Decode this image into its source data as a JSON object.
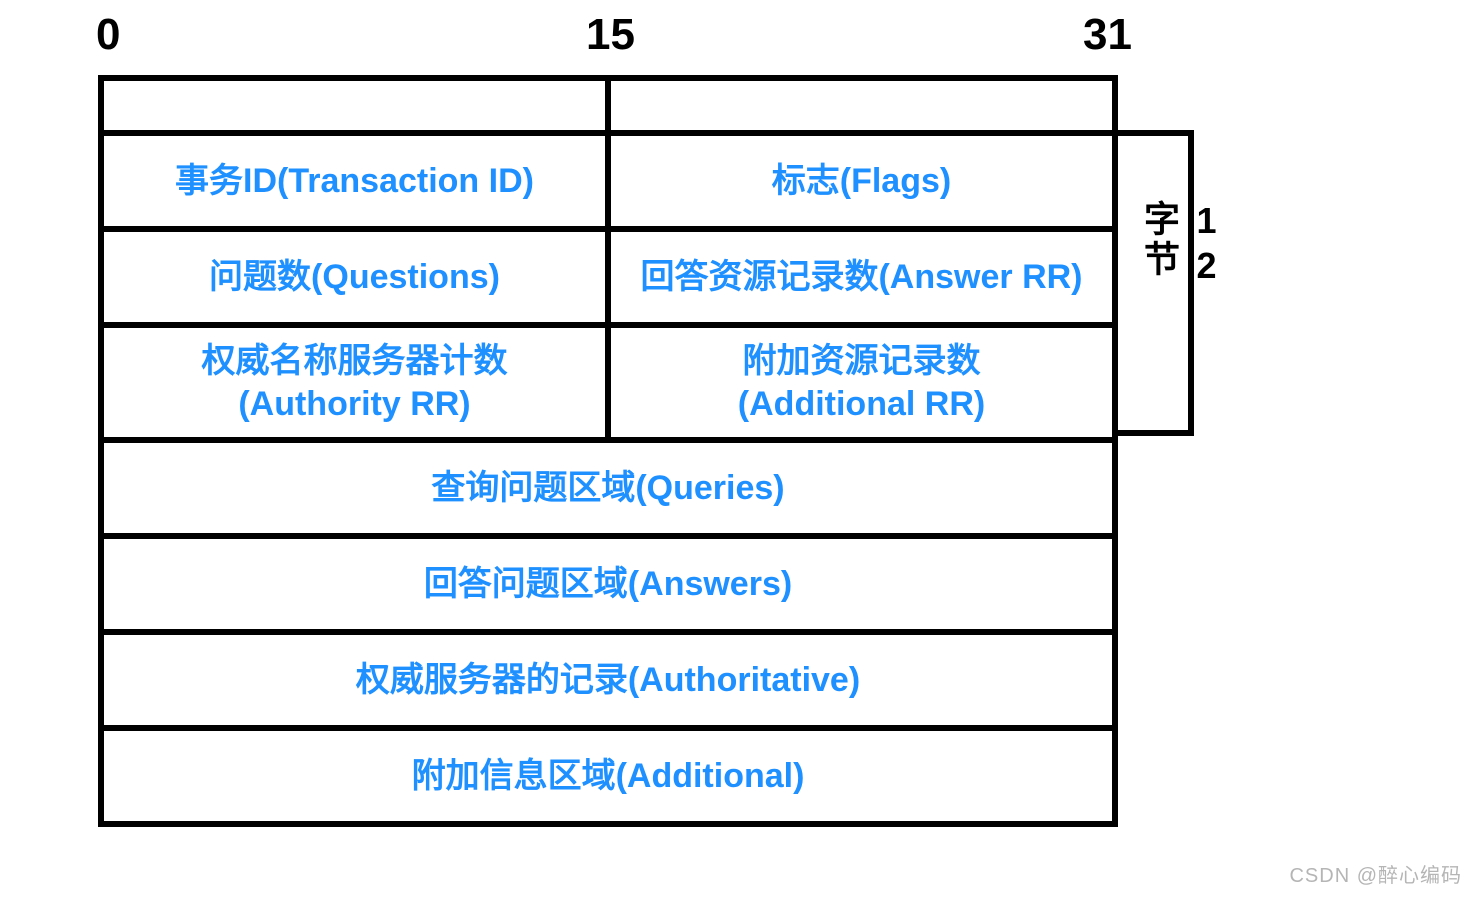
{
  "ruler": {
    "start": "0",
    "mid": "15",
    "end": "31"
  },
  "header_rows": [
    {
      "left": "事务ID(Transaction ID)",
      "right": "标志(Flags)"
    },
    {
      "left": "问题数(Questions)",
      "right": "回答资源记录数(Answer RR)"
    },
    {
      "left_line1": "权威名称服务器计数",
      "left_line2": "(Authority RR)",
      "right_line1": "附加资源记录数",
      "right_line2": "(Additional RR)"
    }
  ],
  "body_rows": [
    "查询问题区域(Queries)",
    "回答问题区域(Answers)",
    "权威服务器的记录(Authoritative)",
    "附加信息区域(Additional)"
  ],
  "side_note": "12字节",
  "watermark": "CSDN @醉心编码",
  "colors": {
    "field_text": "#1e90ff",
    "border": "#000000"
  }
}
